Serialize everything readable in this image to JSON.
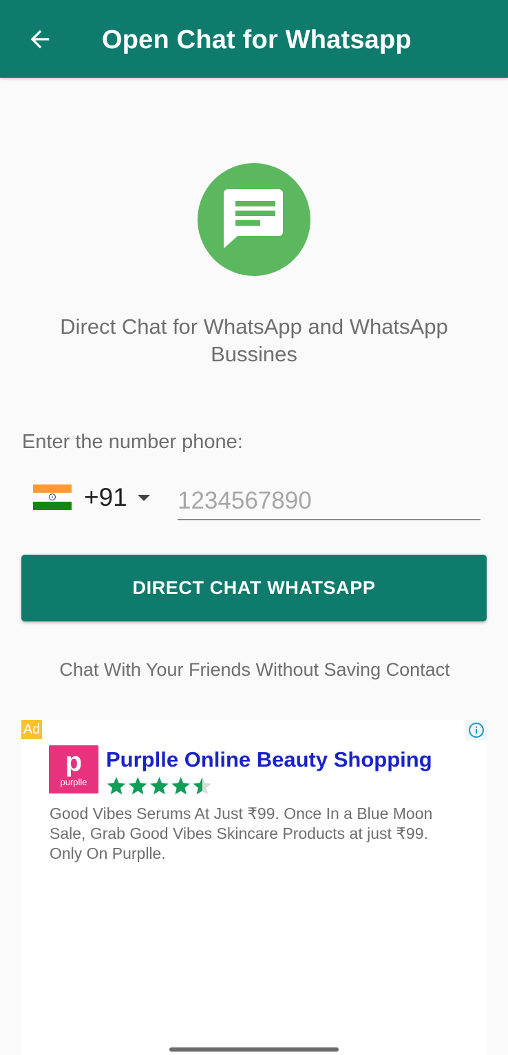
{
  "appbar": {
    "title": "Open Chat for Whatsapp",
    "back_icon": "arrow-left-icon",
    "color": "#0f7b6c"
  },
  "hero": {
    "icon": "chat-message-icon",
    "icon_color": "#5cb85f",
    "subtitle": "Direct Chat for WhatsApp and WhatsApp Bussines"
  },
  "form": {
    "label": "Enter the number phone:",
    "country_flag": "india-flag-icon",
    "country_code": "+91",
    "phone_placeholder": "1234567890",
    "phone_value": ""
  },
  "actions": {
    "direct_chat_label": "DIRECT CHAT WHATSAPP"
  },
  "tagline": "Chat With Your Friends Without Saving Contact",
  "ad": {
    "badge": "Ad",
    "info_icon": "info-icon",
    "logo_letter": "p",
    "logo_text": "purplle",
    "title": "Purplle Online Beauty Shopping",
    "rating": 4.5,
    "rating_max": 5,
    "body": "Good Vibes Serums At Just ₹99. Once In a Blue Moon Sale, Grab Good Vibes Skincare Products at just ₹99. Only On Purplle."
  }
}
